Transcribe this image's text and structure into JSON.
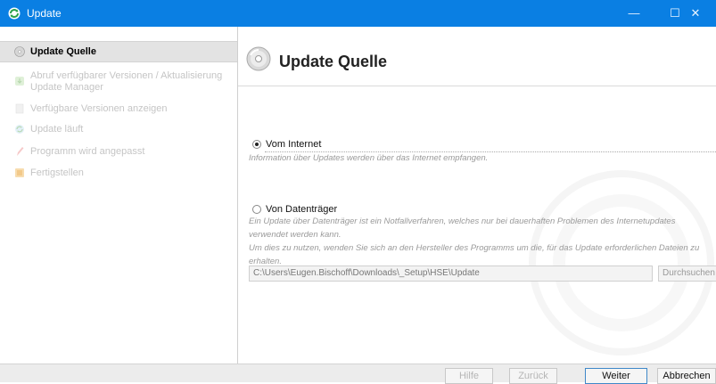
{
  "window": {
    "title": "Update",
    "minimize": "—",
    "maximize": "☐",
    "close": "✕"
  },
  "sidebar": {
    "items": [
      {
        "label": "Update Quelle",
        "icon": "cd-icon",
        "active": true
      },
      {
        "label": "Abruf verfügbarer Versionen / Aktualisierung Update Manager",
        "icon": "download-icon",
        "active": false
      },
      {
        "label": "Verfügbare Versionen anzeigen",
        "icon": "document-icon",
        "active": false
      },
      {
        "label": "Update läuft",
        "icon": "update-icon",
        "active": false
      },
      {
        "label": "Programm wird angepasst",
        "icon": "pencil-icon",
        "active": false
      },
      {
        "label": "Fertigstellen",
        "icon": "finish-icon",
        "active": false
      }
    ]
  },
  "main": {
    "title": "Update Quelle",
    "option_internet": {
      "label": "Vom Internet",
      "checked": true,
      "description": "Information über Updates werden über das Internet empfangen."
    },
    "option_disk": {
      "label": "Von Datenträger",
      "checked": false,
      "description_lines": [
        "Ein Update über Datenträger ist ein Notfallverfahren, welches nur bei dauerhaften Problemen des Internetupdates",
        "verwendet werden kann.",
        "Um dies zu nutzen, wenden Sie sich an den Hersteller des Programms um die, für das Update erforderlichen Dateien zu",
        "erhalten."
      ],
      "path_value": "C:\\Users\\Eugen.Bischoff\\Downloads\\_Setup\\HSE\\Update",
      "browse_label": "Durchsuchen"
    }
  },
  "footer": {
    "help": "Hilfe",
    "back": "Zurück",
    "next": "Weiter",
    "cancel": "Abbrechen"
  },
  "colors": {
    "titlebar": "#0a7fe3",
    "sidebar_active": "#e3e3e3",
    "primary_border": "#3f88c9"
  }
}
